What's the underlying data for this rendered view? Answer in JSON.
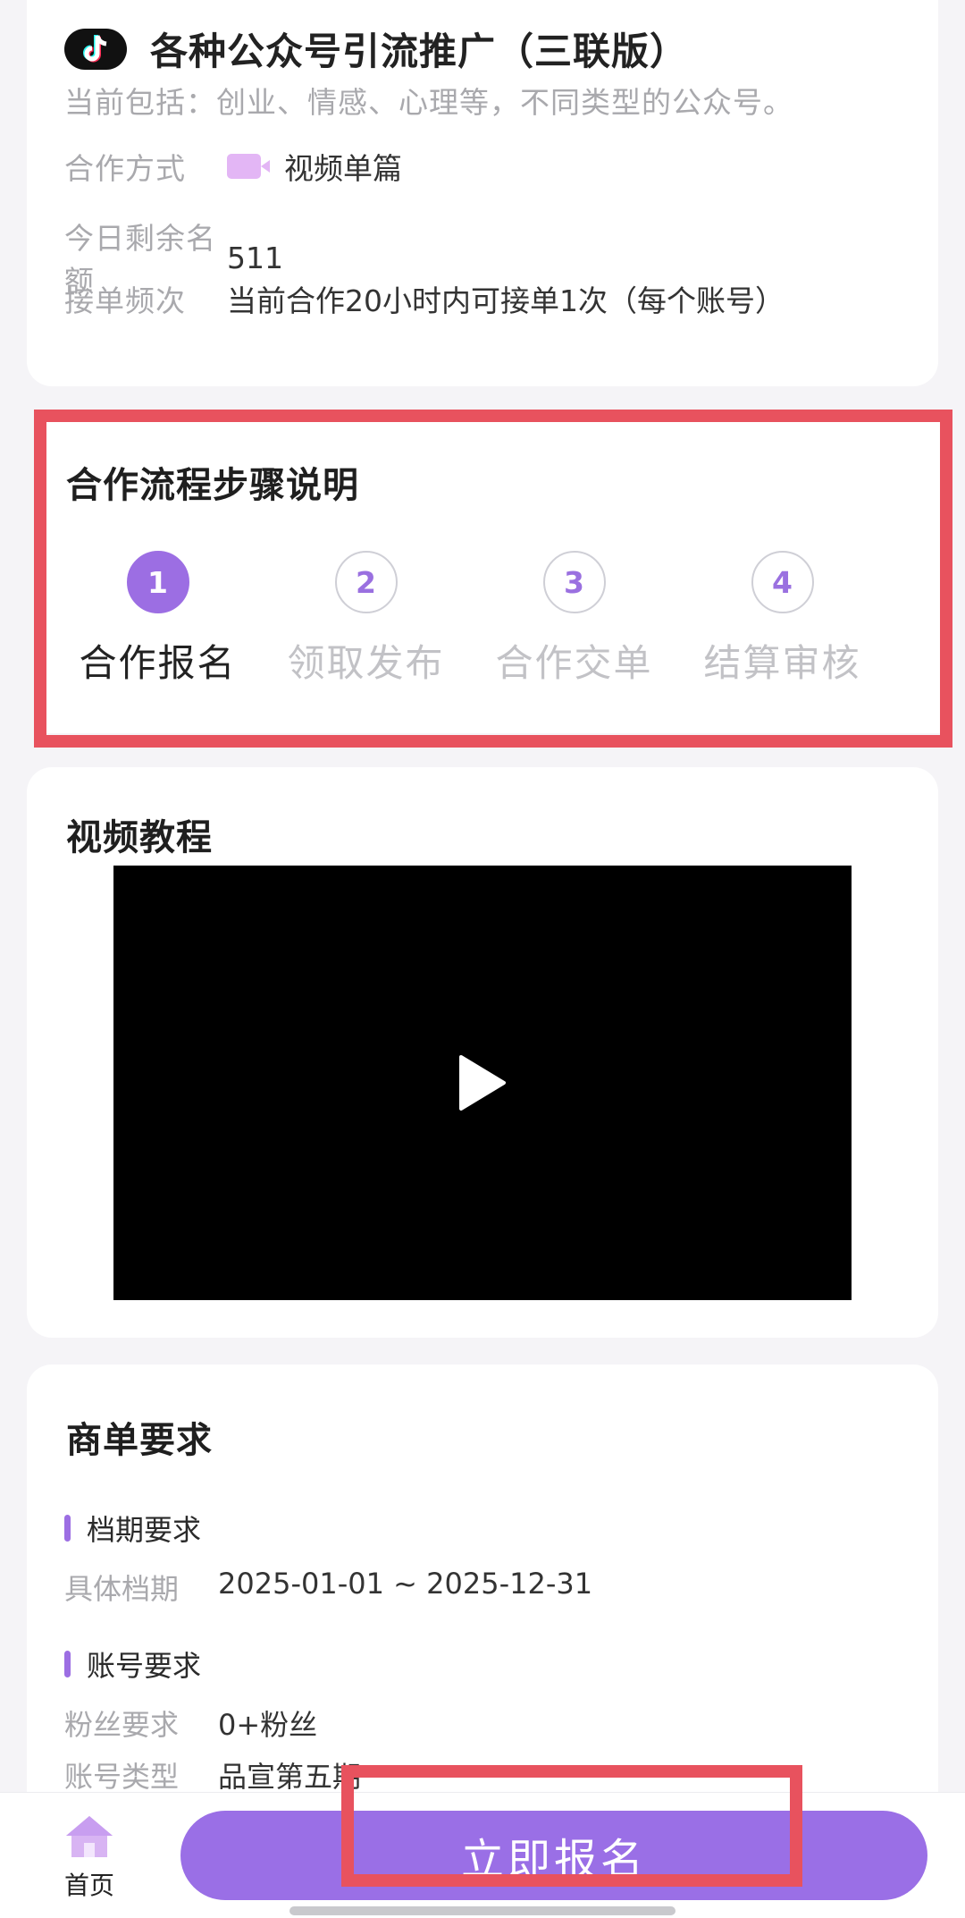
{
  "task": {
    "title": "各种公众号引流推广（三联版）",
    "description": "当前包括：创业、情感、心理等，不同类型的公众号。",
    "info": [
      {
        "label": "合作方式",
        "value": "视频单篇",
        "icon": "video-camera-icon"
      },
      {
        "label": "今日剩余名额",
        "value": "511"
      },
      {
        "label": "接单频次",
        "value": "当前合作20小时内可接单1次（每个账号）"
      }
    ]
  },
  "process": {
    "title": "合作流程步骤说明",
    "steps": [
      {
        "number": "1",
        "label": "合作报名",
        "active": true
      },
      {
        "number": "2",
        "label": "领取发布",
        "active": false
      },
      {
        "number": "3",
        "label": "合作交单",
        "active": false
      },
      {
        "number": "4",
        "label": "结算审核",
        "active": false
      }
    ]
  },
  "video": {
    "title": "视频教程",
    "icon": "play-icon"
  },
  "requirements": {
    "title": "商单要求",
    "schedule": {
      "heading": "档期要求",
      "label": "具体档期",
      "value": "2025-01-01 ~ 2025-12-31"
    },
    "account": {
      "heading": "账号要求",
      "fans_label": "粉丝要求",
      "fans_value": "0+粉丝",
      "type_label": "账号类型",
      "type_value": "品宣第五期"
    }
  },
  "bottom_bar": {
    "home_label": "首页",
    "apply_label": "立即报名"
  },
  "colors": {
    "accent": "#9c6ee3",
    "highlight": "#e8525e",
    "background": "#f5f4f7"
  }
}
